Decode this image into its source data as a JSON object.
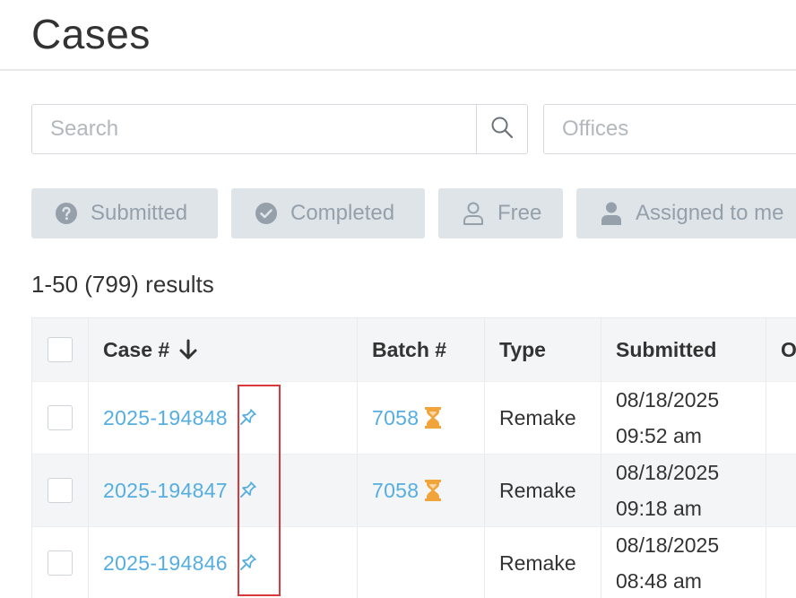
{
  "header": {
    "title": "Cases"
  },
  "search": {
    "placeholder": "Search"
  },
  "offices": {
    "placeholder": "Offices"
  },
  "filters": [
    {
      "label": "Submitted",
      "icon": "question-circle-icon"
    },
    {
      "label": "Completed",
      "icon": "check-circle-icon"
    },
    {
      "label": "Free",
      "icon": "user-outline-icon"
    },
    {
      "label": "Assigned to me",
      "icon": "user-solid-icon"
    }
  ],
  "results": {
    "text": "1-50 (799) results"
  },
  "table": {
    "columns": {
      "case": "Case #",
      "batch": "Batch #",
      "type": "Type",
      "submitted": "Submitted",
      "other": "O"
    },
    "rows": [
      {
        "case": "2025-194848",
        "batch": "7058",
        "type": "Remake",
        "date": "08/18/2025",
        "time": "09:52 am"
      },
      {
        "case": "2025-194847",
        "batch": "7058",
        "type": "Remake",
        "date": "08/18/2025",
        "time": "09:18 am"
      },
      {
        "case": "2025-194846",
        "batch": "",
        "type": "Remake",
        "date": "08/18/2025",
        "time": "08:48 am"
      }
    ]
  },
  "colors": {
    "link": "#55aee0",
    "hourglass": "#f0a43a",
    "filter_bg": "#dfe4e8",
    "filter_text": "#95a0aa",
    "highlight": "#d9383c"
  }
}
